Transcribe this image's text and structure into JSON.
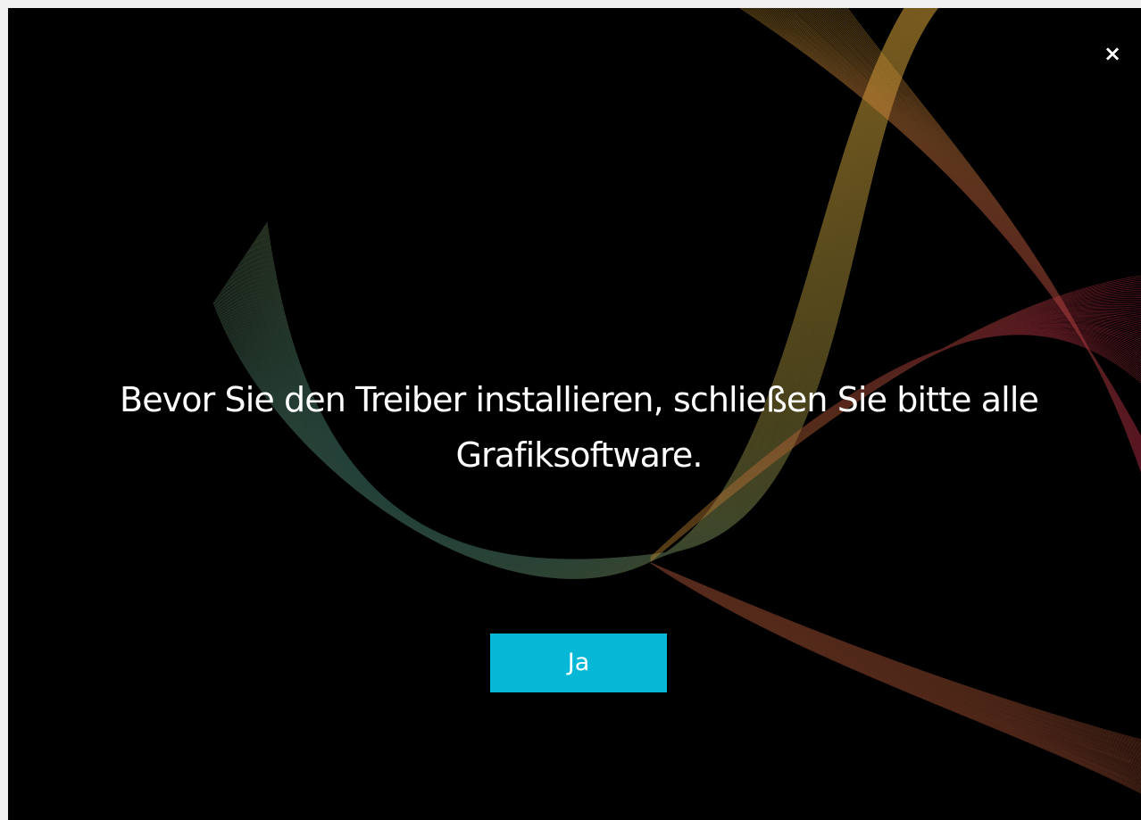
{
  "dialog": {
    "close_glyph": "×",
    "message": "Bevor Sie den Treiber installieren, schließen Sie bitte alle Grafiksoftware.",
    "confirm_label": "Ja"
  },
  "colors": {
    "background": "#000000",
    "text": "#ffffff",
    "accent": "#06b8d6",
    "wave_cool": "#1f6f7a",
    "wave_warm": "#e0a83a",
    "wave_red": "#c0304a"
  },
  "icons": {
    "close": "close-icon"
  }
}
